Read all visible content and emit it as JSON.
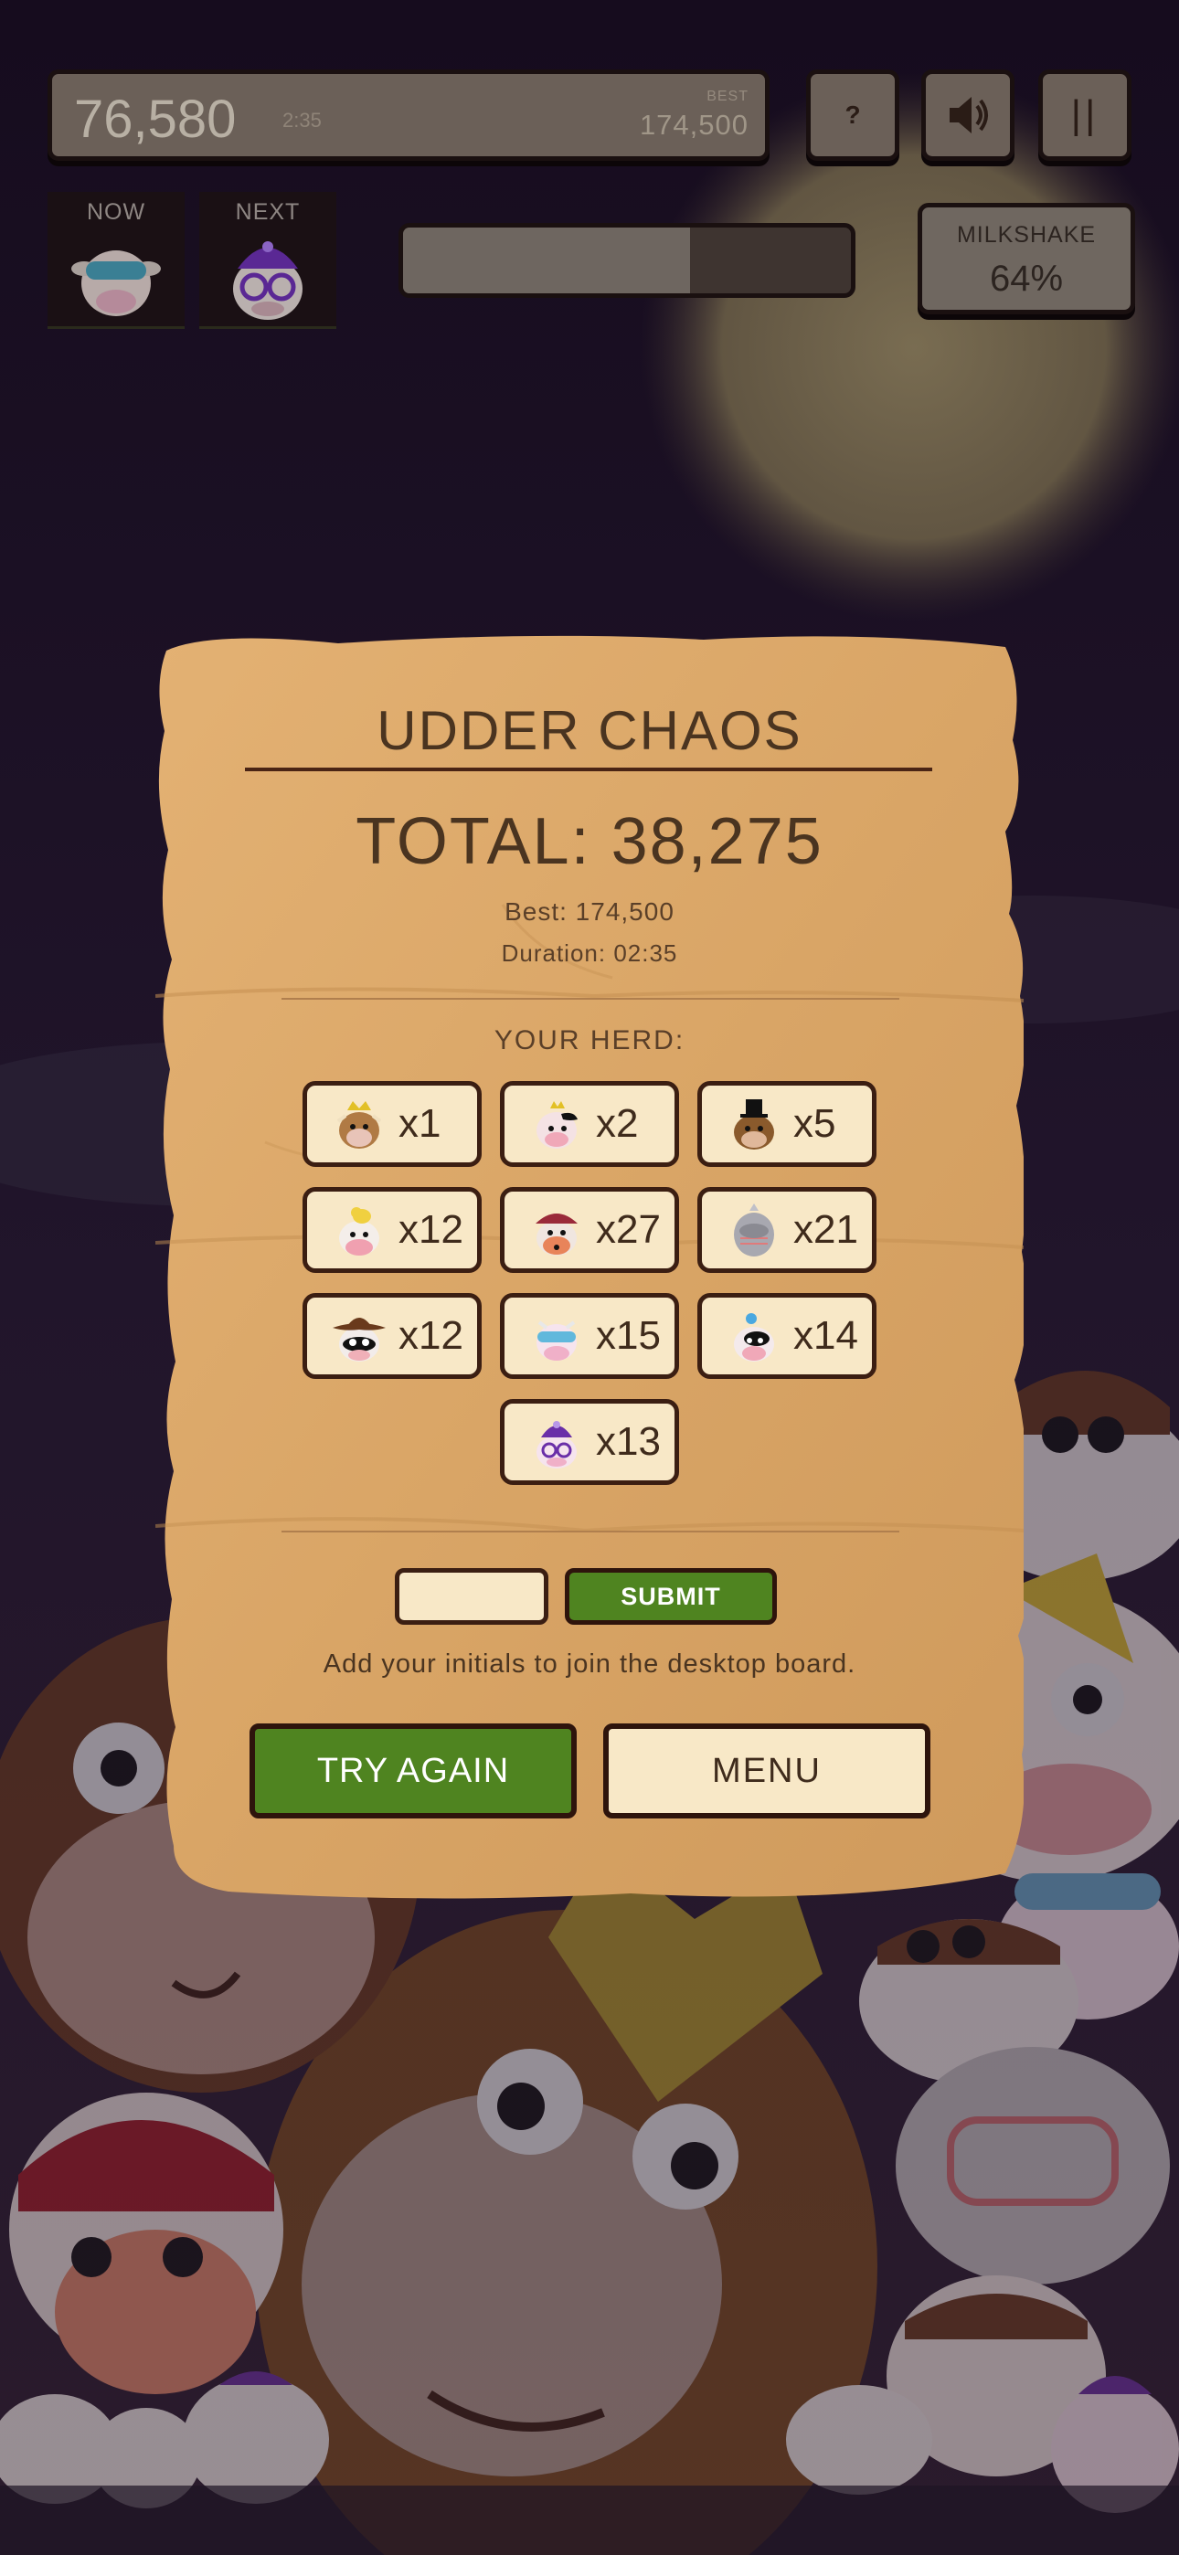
{
  "hud": {
    "score": "76,580",
    "time": "2:35",
    "best_label": "BEST",
    "best_value": "174,500",
    "help_label": "?",
    "pause_label": "||",
    "now_label": "NOW",
    "next_label": "NEXT",
    "progress": 0.64,
    "milkshake_label": "MILKSHAKE",
    "milkshake_value": "64%"
  },
  "panel": {
    "title": "UDDER CHAOS",
    "total": "TOTAL: 38,275",
    "best": "Best: 174,500",
    "duration": "Duration: 02:35",
    "herd_label": "YOUR HERD:",
    "herd": [
      {
        "icon": "crown-cow-icon",
        "count": "x1"
      },
      {
        "icon": "pink-crown-cow-icon",
        "count": "x2"
      },
      {
        "icon": "top-hat-cow-icon",
        "count": "x5"
      },
      {
        "icon": "duck-hat-cow-icon",
        "count": "x12"
      },
      {
        "icon": "red-hat-cow-icon",
        "count": "x27"
      },
      {
        "icon": "knight-cow-icon",
        "count": "x21"
      },
      {
        "icon": "cowboy-cow-icon",
        "count": "x12"
      },
      {
        "icon": "sleep-mask-cow-icon",
        "count": "x15"
      },
      {
        "icon": "blue-bow-cow-icon",
        "count": "x14"
      },
      {
        "icon": "glasses-cow-icon",
        "count": "x13"
      }
    ],
    "initials_placeholder": "",
    "submit_label": "SUBMIT",
    "hint": "Add your initials to join the desktop board.",
    "try_again_label": "TRY AGAIN",
    "menu_label": "MENU"
  },
  "colors": {
    "background": "#1b1024",
    "parchment": "#d9a566",
    "green": "#4f8420",
    "cream": "#f8e8c7",
    "ink": "#4a3420"
  }
}
